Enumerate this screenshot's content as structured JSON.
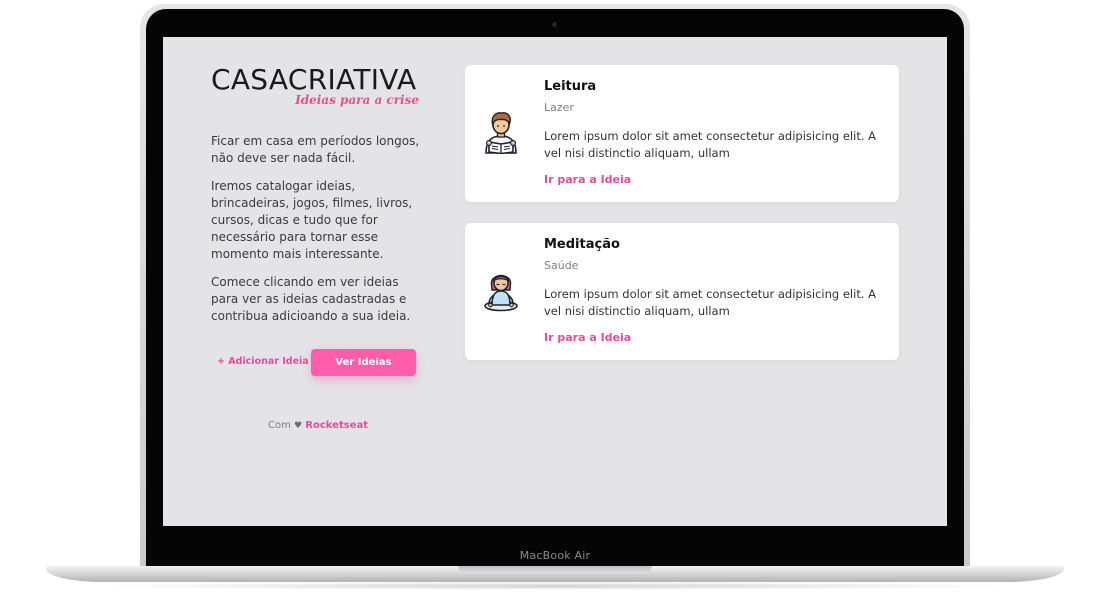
{
  "device": {
    "brand_label": "MacBook Air"
  },
  "logo": {
    "casa": "CASA",
    "criativa": "CRIATIVA",
    "tagline": "Ideias para a crise"
  },
  "intro": {
    "p1": "Ficar em casa em períodos longos, não deve ser nada fácil.",
    "p2": "Iremos catalogar ideias, brincadeiras, jogos, filmes, livros, cursos, dicas e tudo que for necessário para tornar esse momento mais interessante.",
    "p3": "Comece clicando em ver ideias para ver as ideias cadastradas e contribua adicioando a sua ideia."
  },
  "actions": {
    "add_label": "+ Adicionar Ideia",
    "view_label": "Ver Ideias"
  },
  "footer": {
    "prefix": "Com",
    "heart": "♥",
    "link": "Rocketseat"
  },
  "ideas": [
    {
      "title": "Leitura",
      "category": "Lazer",
      "description": "Lorem ipsum dolor sit amet consectetur adipisicing elit. A vel nisi distinctio aliquam, ullam",
      "link": "Ir para a Ideia",
      "icon": "reading-person-icon"
    },
    {
      "title": "Meditação",
      "category": "Saúde",
      "description": "Lorem ipsum dolor sit amet consectetur adipisicing elit. A vel nisi distinctio aliquam, ullam",
      "link": "Ir para a Ideia",
      "icon": "meditation-person-icon"
    }
  ],
  "colors": {
    "accent": "#f0469b",
    "button": "#ff5cab",
    "screen_bg": "#e4e4e6",
    "card_bg": "#ffffff"
  }
}
